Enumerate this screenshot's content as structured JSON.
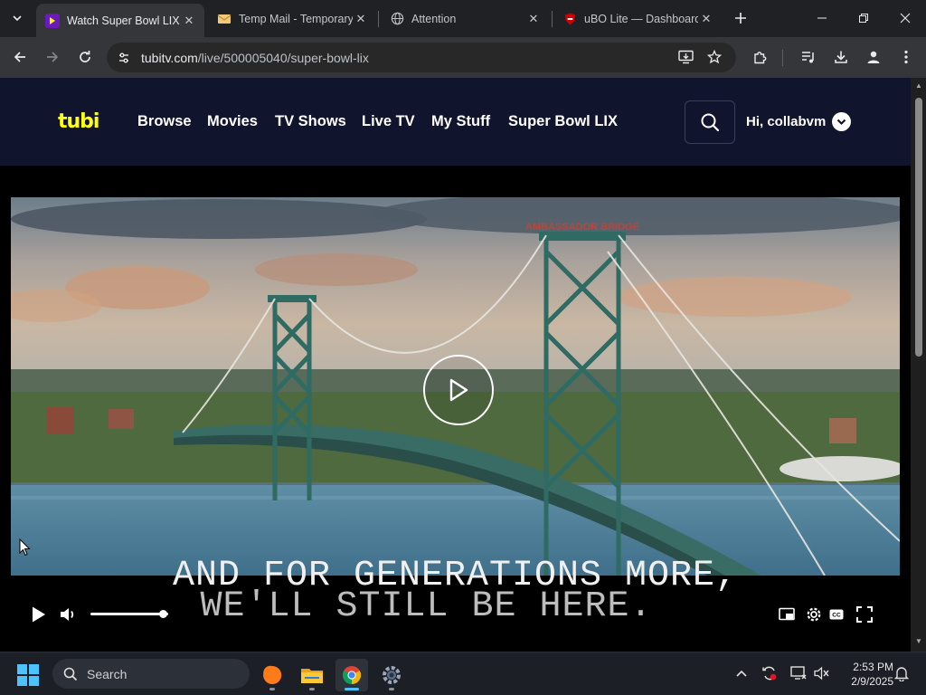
{
  "browser": {
    "tabs": [
      {
        "title": "Watch Super Bowl LIX ...",
        "icon": "tubi-favicon",
        "active": true
      },
      {
        "title": "Temp Mail - Temporary ...",
        "icon": "envelope-favicon",
        "active": false
      },
      {
        "title": "Attention",
        "icon": "globe-favicon",
        "active": false
      },
      {
        "title": "uBO Lite — Dashboard",
        "icon": "ublock-favicon",
        "active": false
      }
    ],
    "url": {
      "host": "tubitv.com",
      "path": "/live/500005040/super-bowl-lix"
    }
  },
  "site": {
    "logo": "tubi",
    "nav": [
      "Browse",
      "Movies",
      "TV Shows",
      "Live TV",
      "My Stuff",
      "Super Bowl LIX"
    ],
    "greeting": "Hi, collabvm"
  },
  "video": {
    "subtitle_line1": "AND FOR GENERATIONS MORE,",
    "subtitle_line2": "WE'LL STILL BE HERE.",
    "bridge_sign": "AMBASSADOR BRIDGE",
    "volume_level": 0.93
  },
  "taskbar": {
    "search_label": "Search",
    "time": "2:53 PM",
    "date": "2/9/2025"
  },
  "colors": {
    "tubi_yellow": "#ffff13",
    "header_bg": "#10142c",
    "chrome_tab_active": "#35363a",
    "win_accent": "#4cc2ff"
  }
}
